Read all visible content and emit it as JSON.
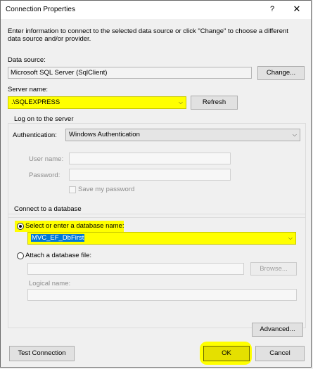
{
  "window": {
    "title": "Connection Properties",
    "help_glyph": "?",
    "close_glyph": "✕"
  },
  "intro": {
    "line1": "Enter information to connect to the selected data source or click \"Change\" to choose a different",
    "line2": "data source and/or provider."
  },
  "data_source": {
    "label": "Data source:",
    "value": "Microsoft SQL Server (SqlClient)",
    "change_button": "Change..."
  },
  "server": {
    "label": "Server name:",
    "value": ".\\SQLEXPRESS",
    "refresh_button": "Refresh"
  },
  "logon": {
    "group_title": "Log on to the server",
    "auth_label": "Authentication:",
    "auth_value": "Windows Authentication",
    "user_label": "User name:",
    "password_label": "Password:",
    "save_password_label": "Save my password"
  },
  "database": {
    "group_title": "Connect to a database",
    "select_label": "Select or enter a database name:",
    "select_value": "MVC_EF_DbFirst",
    "attach_label": "Attach a database file:",
    "browse_button": "Browse...",
    "logical_label": "Logical name:"
  },
  "buttons": {
    "advanced": "Advanced...",
    "test_connection": "Test Connection",
    "ok": "OK",
    "cancel": "Cancel"
  },
  "icons": {
    "dropdown": "chevron-down-icon"
  },
  "colors": {
    "highlight": "#ffff00",
    "selection": "#0078d7"
  }
}
